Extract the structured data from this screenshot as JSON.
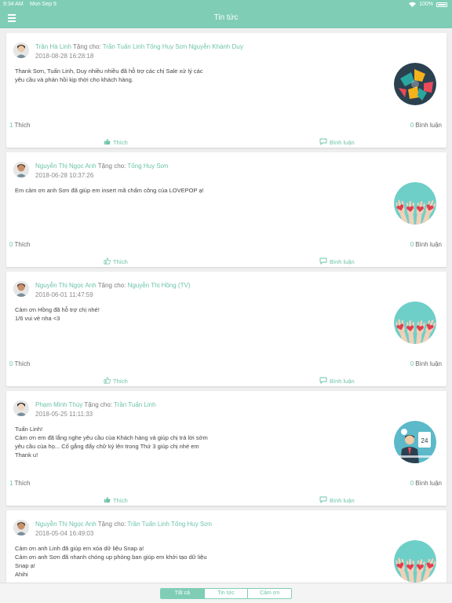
{
  "status_bar": {
    "time": "9:34 AM",
    "date": "Mon Sep 9",
    "battery": "100%",
    "wifi_icon": "wifi-icon"
  },
  "header": {
    "title": "Tin tức",
    "menu_icon": "menu-icon"
  },
  "posts": [
    {
      "author": "Trần Hà Linh",
      "gift_label": "Tặng cho:",
      "receivers": "Trần Tuấn Linh Tống Huy Sơn Nguyễn Khánh Duy",
      "date": "2018-08-28 16:28:18",
      "message_lines": [
        "Thank Sơn, Tuấn Linh, Duy nhiều nhiều đã hỗ trợ các chị Sale xử lý các",
        "yêu cầu và phản hồi kịp thời cho khách hàng."
      ],
      "likes": "1",
      "likes_label": "Thích",
      "comments": "0",
      "comments_label": "Bình luận",
      "like_button": "Thích",
      "comment_button": "Bình luận",
      "liked": true,
      "sticker": "puzzle-teamwork"
    },
    {
      "author": "Nguyễn Thị Ngọc Anh",
      "gift_label": "Tặng cho:",
      "receivers": "Tống Huy Sơn",
      "date": "2018-06-28 10:37:26",
      "message_lines": [
        "Em cảm ơn anh Sơn đã giúp em insert mã chấm công của LOVEPOP ạ!"
      ],
      "likes": "0",
      "likes_label": "Thích",
      "comments": "0",
      "comments_label": "Bình luận",
      "like_button": "Thích",
      "comment_button": "Bình luận",
      "liked": false,
      "sticker": "hands-hearts"
    },
    {
      "author": "Nguyễn Thị Ngọc Anh",
      "gift_label": "Tặng cho:",
      "receivers": "Nguyễn Thị Hồng (TV)",
      "date": "2018-06-01 11:47:59",
      "message_lines": [
        "Cảm ơn Hồng đã hỗ trợ chị nhé!",
        "1/6 vui vẻ nha <3"
      ],
      "likes": "0",
      "likes_label": "Thích",
      "comments": "0",
      "comments_label": "Bình luận",
      "like_button": "Thích",
      "comment_button": "Bình luận",
      "liked": false,
      "sticker": "hands-hearts"
    },
    {
      "author": "Phạm Minh Thúy",
      "gift_label": "Tặng cho:",
      "receivers": "Trần Tuấn Linh",
      "date": "2018-05-25 11:11:33",
      "message_lines": [
        "Tuấn Linh!",
        "Cảm ơn em đã lắng nghe yêu cầu của Khách hàng và giúp chị trả lời sớm",
        "yêu cầu của họ... Cố gắng đẩy chữ ký lên trong Thứ 3 giúp chị nhé em",
        "Thank u!"
      ],
      "likes": "1",
      "likes_label": "Thích",
      "comments": "0",
      "comments_label": "Bình luận",
      "like_button": "Thích",
      "comment_button": "Bình luận",
      "liked": true,
      "sticker": "support-24"
    },
    {
      "author": "Nguyễn Thị Ngọc Anh",
      "gift_label": "Tặng cho:",
      "receivers": "Trần Tuấn Linh Tống Huy Sơn",
      "date": "2018-05-04 16:49:03",
      "message_lines": [
        "Cảm ơn anh Linh đã giúp em xóa dữ liệu Snap ạ!",
        "Cảm ơn anh Sơn đã nhanh chóng up phòng ban giúp em khởi tạo dữ liệu",
        "Snap ạ!",
        "Ahihi"
      ],
      "likes": "",
      "likes_label": "",
      "comments": "",
      "comments_label": "",
      "like_button": "",
      "comment_button": "",
      "liked": false,
      "sticker": "hands-hearts"
    }
  ],
  "tabs": [
    {
      "label": "Tất cả",
      "active": true
    },
    {
      "label": "Tin tức",
      "active": false
    },
    {
      "label": "Cảm ơn",
      "active": false
    }
  ],
  "colors": {
    "accent": "#7fcdb5",
    "accent_text": "#6dc3ab"
  }
}
